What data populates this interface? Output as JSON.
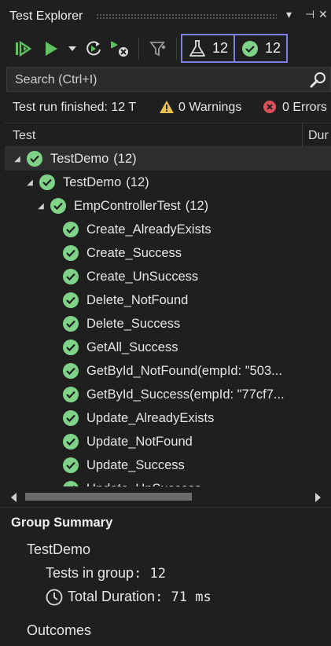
{
  "window": {
    "title": "Test Explorer",
    "pin_glyph": "⊣",
    "close_glyph": "✕",
    "menu_glyph": "▾"
  },
  "toolbar": {
    "icons": [
      "run-all-icon",
      "run-icon",
      "run-dropdown-icon",
      "repeat-last-run-icon",
      "cancel-icon",
      "filter-icon"
    ],
    "total_tests": "12",
    "passed_tests": "12"
  },
  "search": {
    "placeholder": "Search (Ctrl+I)"
  },
  "status": {
    "summary": "Test run finished: 12 T",
    "warnings": "0 Warnings",
    "errors": "0 Errors"
  },
  "columns": {
    "test": "Test",
    "duration": "Dur"
  },
  "tree": [
    {
      "label": "TestDemo",
      "count": "(12)",
      "level": 0,
      "expanded": true,
      "status": "passed"
    },
    {
      "label": "TestDemo",
      "count": "(12)",
      "level": 1,
      "expanded": true,
      "status": "passed"
    },
    {
      "label": "EmpControllerTest",
      "count": "(12)",
      "level": 2,
      "expanded": true,
      "status": "passed"
    },
    {
      "label": "Create_AlreadyExists",
      "level": 3,
      "status": "passed"
    },
    {
      "label": "Create_Success",
      "level": 3,
      "status": "passed"
    },
    {
      "label": "Create_UnSuccess",
      "level": 3,
      "status": "passed"
    },
    {
      "label": "Delete_NotFound",
      "level": 3,
      "status": "passed"
    },
    {
      "label": "Delete_Success",
      "level": 3,
      "status": "passed"
    },
    {
      "label": "GetAll_Success",
      "level": 3,
      "status": "passed"
    },
    {
      "label": "GetById_NotFound(empId: \"503...",
      "level": 3,
      "status": "passed"
    },
    {
      "label": "GetById_Success(empId: \"77cf7...",
      "level": 3,
      "status": "passed"
    },
    {
      "label": "Update_AlreadyExists",
      "level": 3,
      "status": "passed"
    },
    {
      "label": "Update_NotFound",
      "level": 3,
      "status": "passed"
    },
    {
      "label": "Update_Success",
      "level": 3,
      "status": "passed"
    },
    {
      "label": "Update_UnSuccess",
      "level": 3,
      "status": "passed"
    }
  ],
  "group_summary": {
    "title": "Group Summary",
    "group_name": "TestDemo",
    "tests_label": "Tests in group",
    "tests_value": "12",
    "duration_label": "Total Duration",
    "duration_value": "71 ms",
    "outcomes_label": "Outcomes"
  },
  "colors": {
    "pass": "#7ed389",
    "accent_border": "#7f7fe8",
    "run_green": "#5fc25f",
    "warning": "#e8c04a",
    "error": "#e0505b"
  }
}
